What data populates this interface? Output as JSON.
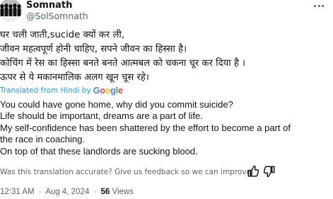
{
  "author": {
    "name": "Somnath",
    "handle": "@SolSomnath"
  },
  "icons": {
    "more": "more-horizontal-icon",
    "thumb_up": "thumbs-up-icon",
    "thumb_down": "thumbs-down-icon"
  },
  "original_text": [
    "घर चली जाती,sucide क्यों कर ली,",
    "जीवन महत्वपूर्ण होनी चाहिए, सपने जीवन का हिस्सा है।",
    "कोचिंग में रेस का हिस्सा बनते बनते आत्मबल को चकना चूर कर दिया है ।",
    "ऊपर से ये मकानमालिक अलग खून चूस रहे।"
  ],
  "translation_source": {
    "prefix": "Translated from Hindi by",
    "brand": "Google"
  },
  "translated_text": [
    "You could have gone home, why did you commit suicide?",
    "Life should be important, dreams are a part of life.",
    "My self-confidence has been shattered by the effort to become a part of",
    "the race in coaching.",
    "On top of that these landlords are sucking blood."
  ],
  "feedback": {
    "text": "Was this translation accurate? Give us feedback so we can improve:"
  },
  "meta": {
    "time": "12:31 AM",
    "date": "Aug 4, 2024",
    "separator": "·",
    "views_count": "56",
    "views_label": "Views"
  },
  "colors": {
    "text": "#0f1419",
    "secondary": "#536471",
    "link": "#1d9bf0"
  }
}
